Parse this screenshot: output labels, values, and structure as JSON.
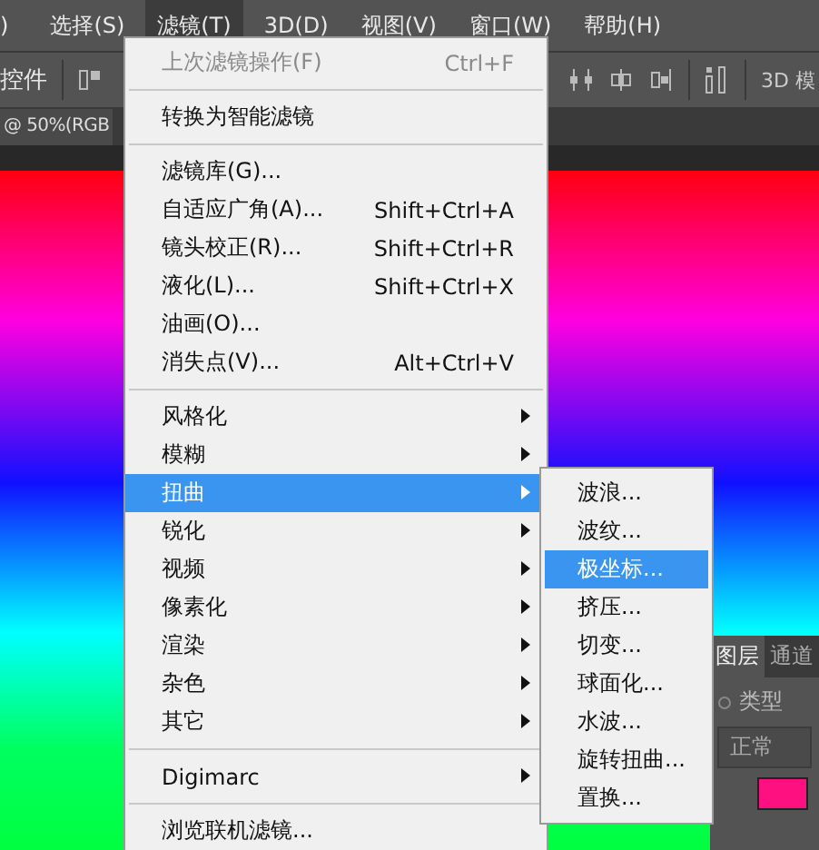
{
  "menubar": {
    "items": [
      {
        "label": ")",
        "selected": false
      },
      {
        "label": "选择(S)",
        "selected": false
      },
      {
        "label": "滤镜(T)",
        "selected": true
      },
      {
        "label": "3D(D)",
        "selected": false
      },
      {
        "label": "视图(V)",
        "selected": false
      },
      {
        "label": "窗口(W)",
        "selected": false
      },
      {
        "label": "帮助(H)",
        "selected": false
      }
    ]
  },
  "options_bar": {
    "label": "控件",
    "right_label": "3D 模"
  },
  "document_tab": {
    "title": "@ 50%(RGB"
  },
  "layers_panel": {
    "tabs": [
      {
        "label": "图层",
        "selected": true
      },
      {
        "label": "通道",
        "selected": false
      }
    ],
    "filter_label": "类型",
    "blend_mode": "正常"
  },
  "filter_menu": {
    "items": [
      {
        "kind": "item",
        "label": "上次滤镜操作(F)",
        "shortcut": "Ctrl+F",
        "disabled": true,
        "selected": false,
        "has_submenu": false
      },
      {
        "kind": "separator"
      },
      {
        "kind": "item",
        "label": "转换为智能滤镜",
        "disabled": false,
        "selected": false,
        "has_submenu": false
      },
      {
        "kind": "separator"
      },
      {
        "kind": "item",
        "label": "滤镜库(G)...",
        "disabled": false,
        "selected": false,
        "has_submenu": false
      },
      {
        "kind": "item",
        "label": "自适应广角(A)...",
        "shortcut": "Shift+Ctrl+A",
        "disabled": false,
        "selected": false,
        "has_submenu": false
      },
      {
        "kind": "item",
        "label": "镜头校正(R)...",
        "shortcut": "Shift+Ctrl+R",
        "disabled": false,
        "selected": false,
        "has_submenu": false
      },
      {
        "kind": "item",
        "label": "液化(L)...",
        "shortcut": "Shift+Ctrl+X",
        "disabled": false,
        "selected": false,
        "has_submenu": false
      },
      {
        "kind": "item",
        "label": "油画(O)...",
        "disabled": false,
        "selected": false,
        "has_submenu": false
      },
      {
        "kind": "item",
        "label": "消失点(V)...",
        "shortcut": "Alt+Ctrl+V",
        "disabled": false,
        "selected": false,
        "has_submenu": false
      },
      {
        "kind": "separator"
      },
      {
        "kind": "item",
        "label": "风格化",
        "disabled": false,
        "selected": false,
        "has_submenu": true
      },
      {
        "kind": "item",
        "label": "模糊",
        "disabled": false,
        "selected": false,
        "has_submenu": true
      },
      {
        "kind": "item",
        "label": "扭曲",
        "disabled": false,
        "selected": true,
        "has_submenu": true
      },
      {
        "kind": "item",
        "label": "锐化",
        "disabled": false,
        "selected": false,
        "has_submenu": true
      },
      {
        "kind": "item",
        "label": "视频",
        "disabled": false,
        "selected": false,
        "has_submenu": true
      },
      {
        "kind": "item",
        "label": "像素化",
        "disabled": false,
        "selected": false,
        "has_submenu": true
      },
      {
        "kind": "item",
        "label": "渲染",
        "disabled": false,
        "selected": false,
        "has_submenu": true
      },
      {
        "kind": "item",
        "label": "杂色",
        "disabled": false,
        "selected": false,
        "has_submenu": true
      },
      {
        "kind": "item",
        "label": "其它",
        "disabled": false,
        "selected": false,
        "has_submenu": true
      },
      {
        "kind": "separator"
      },
      {
        "kind": "item",
        "label": "Digimarc",
        "disabled": false,
        "selected": false,
        "has_submenu": true
      },
      {
        "kind": "separator"
      },
      {
        "kind": "item",
        "label": "浏览联机滤镜...",
        "disabled": false,
        "selected": false,
        "has_submenu": false
      }
    ]
  },
  "submenu": {
    "items": [
      {
        "label": "波浪...",
        "selected": false
      },
      {
        "label": "波纹...",
        "selected": false
      },
      {
        "label": "极坐标...",
        "selected": true
      },
      {
        "label": "挤压...",
        "selected": false
      },
      {
        "label": "切变...",
        "selected": false
      },
      {
        "label": "球面化...",
        "selected": false
      },
      {
        "label": "水波...",
        "selected": false
      },
      {
        "label": "旋转扭曲...",
        "selected": false
      },
      {
        "label": "置换...",
        "selected": false
      }
    ]
  }
}
